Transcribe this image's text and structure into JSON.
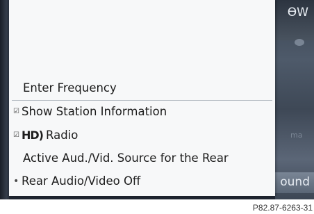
{
  "background": {
    "right_top_text": "ӨW",
    "right_bottom_text": "ound",
    "right_faded_text": "ma"
  },
  "menu": {
    "items": [
      {
        "label": "Enter Frequency"
      },
      {
        "label": "Show Station Information",
        "checked": true
      },
      {
        "label": "Radio",
        "prefix_logo": "HD)",
        "checked": true
      },
      {
        "label": "Active Aud./Vid. Source for the Rear"
      },
      {
        "label": "Rear Audio/Video Off",
        "bullet": true
      }
    ]
  },
  "caption": "P82.87-6263-31"
}
